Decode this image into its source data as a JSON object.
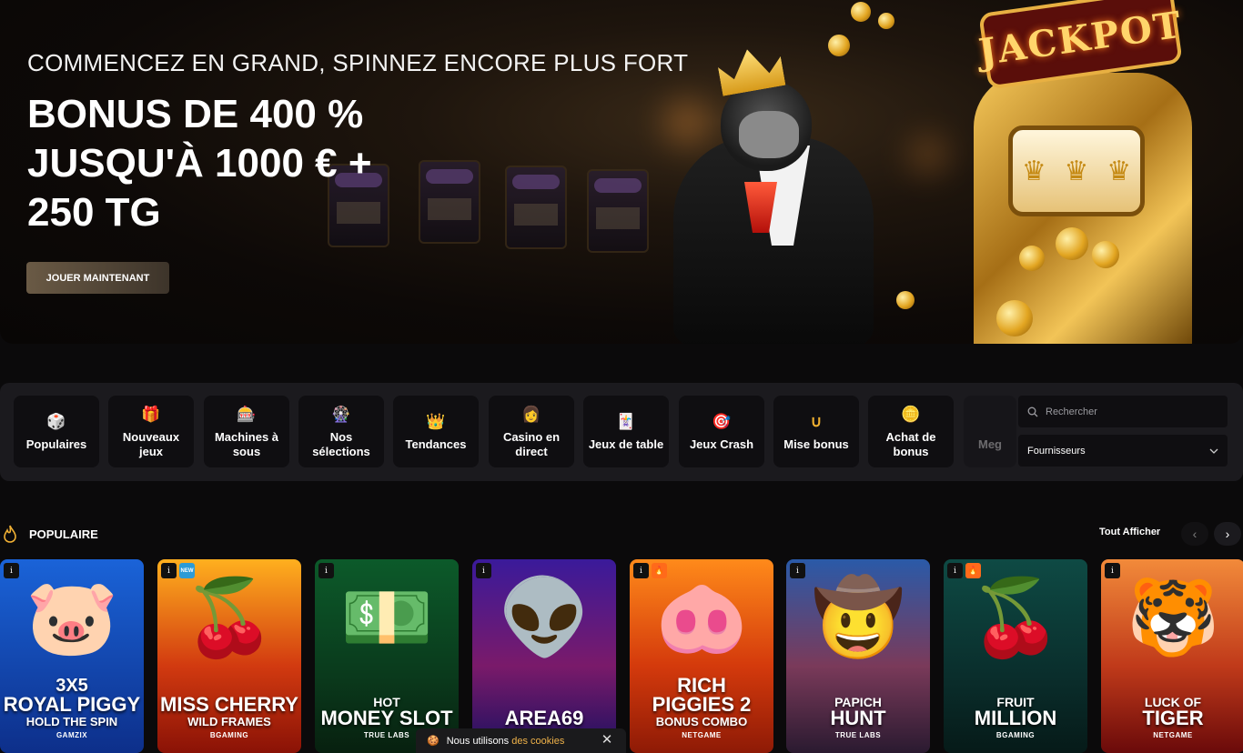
{
  "hero": {
    "kicker": "COMMENCEZ EN GRAND, SPINNEZ ENCORE PLUS FORT",
    "title": "BONUS DE 400 % JUSQU'À 1000 € + 250 TG",
    "cta": "JOUER MAINTENANT",
    "jackpot_sign": "JACKPOT"
  },
  "categories": [
    {
      "label": "Populaires",
      "icon": "dice-icon"
    },
    {
      "label": "Nouveaux jeux",
      "icon": "gift-icon"
    },
    {
      "label": "Machines à sous",
      "icon": "slot-machine-icon"
    },
    {
      "label": "Nos sélections",
      "icon": "roulette-icon"
    },
    {
      "label": "Tendances",
      "icon": "crown-icon"
    },
    {
      "label": "Casino en direct",
      "icon": "dealer-icon"
    },
    {
      "label": "Jeux de table",
      "icon": "cards-icon"
    },
    {
      "label": "Jeux Crash",
      "icon": "crash-icon"
    },
    {
      "label": "Mise bonus",
      "icon": "horseshoe-icon"
    },
    {
      "label": "Achat de bonus",
      "icon": "bonus-icon"
    },
    {
      "label": "Meg",
      "icon": "mega-icon"
    }
  ],
  "search": {
    "placeholder": "Rechercher"
  },
  "providers": {
    "label": "Fournisseurs"
  },
  "popular": {
    "title": "POPULAIRE",
    "see_all": "Tout Afficher"
  },
  "games": [
    {
      "small": "3X5",
      "big": "ROYAL PIGGY",
      "sub": "HOLD THE SPIN",
      "provider": "GAMZIX",
      "badge": ""
    },
    {
      "small": "",
      "big": "MISS CHERRY",
      "sub": "WILD FRAMES",
      "provider": "BGAMING",
      "badge": "NEW"
    },
    {
      "small": "HOT",
      "big": "MONEY SLOT",
      "sub": "",
      "provider": "TRUE LABS",
      "badge": ""
    },
    {
      "small": "",
      "big": "AREA69",
      "sub": "",
      "provider": "",
      "badge": ""
    },
    {
      "small": "RICH",
      "big": "PIGGIES 2",
      "sub": "BONUS COMBO",
      "provider": "NETGAME",
      "badge": "hot"
    },
    {
      "small": "PAPICH",
      "big": "HUNT",
      "sub": "",
      "provider": "TRUE LABS",
      "badge": ""
    },
    {
      "small": "FRUIT",
      "big": "MILLION",
      "sub": "",
      "provider": "BGAMING",
      "badge": "hot"
    },
    {
      "small": "LUCK OF",
      "big": "TIGER",
      "sub": "",
      "provider": "NETGAME",
      "badge": ""
    }
  ],
  "cookie": {
    "text": "Nous utilisons",
    "link": "des cookies"
  }
}
